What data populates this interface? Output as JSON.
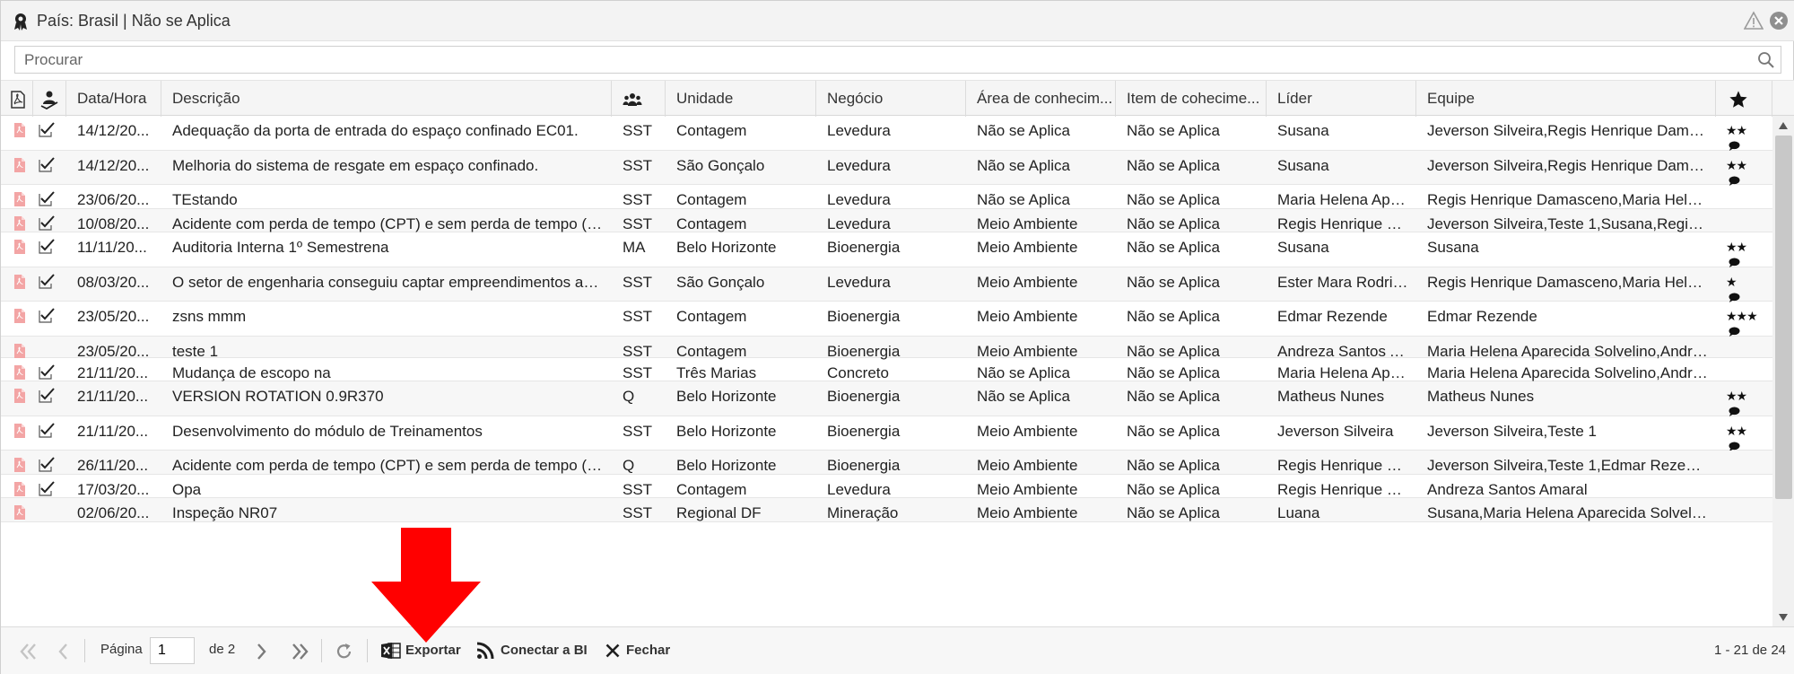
{
  "window": {
    "title": "País: Brasil | Não se Aplica"
  },
  "search": {
    "placeholder": "Procurar"
  },
  "columns": [
    {
      "key": "pdf",
      "label": ""
    },
    {
      "key": "check",
      "label": ""
    },
    {
      "key": "datetime",
      "label": "Data/Hora"
    },
    {
      "key": "description",
      "label": "Descrição"
    },
    {
      "key": "group",
      "label": ""
    },
    {
      "key": "unit",
      "label": "Unidade"
    },
    {
      "key": "business",
      "label": "Negócio"
    },
    {
      "key": "area",
      "label": "Área de conhecim..."
    },
    {
      "key": "item",
      "label": "Item de cohecime..."
    },
    {
      "key": "leader",
      "label": "Líder"
    },
    {
      "key": "team",
      "label": "Equipe"
    },
    {
      "key": "rating",
      "label": ""
    }
  ],
  "rows": [
    {
      "checked": true,
      "datetime": "14/12/20...",
      "description": "Adequação da porta de entrada do espaço confinado EC01.",
      "group": "SST",
      "unit": "Contagem",
      "business": "Levedura",
      "area": "Não se Aplica",
      "item": "Não se Aplica",
      "leader": "Susana",
      "team": "Jeverson Silveira,Regis Henrique Damasc...",
      "stars": "★★",
      "comment": true
    },
    {
      "checked": true,
      "datetime": "14/12/20...",
      "description": "Melhoria do sistema de resgate em espaço confinado.",
      "group": "SST",
      "unit": "São Gonçalo",
      "business": "Levedura",
      "area": "Não se Aplica",
      "item": "Não se Aplica",
      "leader": "Susana",
      "team": "Jeverson Silveira,Regis Henrique Damasc...",
      "stars": "★★",
      "comment": true
    },
    {
      "checked": true,
      "datetime": "23/06/20...",
      "description": "TEstando",
      "group": "SST",
      "unit": "Contagem",
      "business": "Levedura",
      "area": "Não se Aplica",
      "item": "Não se Aplica",
      "leader": "Maria Helena Apar...",
      "team": "Regis Henrique Damasceno,Maria Helena ...",
      "stars": "",
      "comment": false
    },
    {
      "checked": true,
      "datetime": "10/08/20...",
      "description": "Acidente com perda de tempo (CPT) e sem perda de tempo (SPT).",
      "group": "SST",
      "unit": "Contagem",
      "business": "Levedura",
      "area": "Meio Ambiente",
      "item": "Não se Aplica",
      "leader": "Regis Henrique Da...",
      "team": "Jeverson Silveira,Teste 1,Susana,Regis He...",
      "stars": "",
      "comment": false
    },
    {
      "checked": true,
      "datetime": "11/11/20...",
      "description": "Auditoria Interna 1º Semestrena",
      "group": "MA",
      "unit": "Belo Horizonte",
      "business": "Bioenergia",
      "area": "Meio Ambiente",
      "item": "Não se Aplica",
      "leader": "Susana",
      "team": "Susana",
      "stars": "★★",
      "comment": true
    },
    {
      "checked": true,
      "datetime": "08/03/20...",
      "description": "O setor de engenharia conseguiu captar empreendimentos ambie...",
      "group": "SST",
      "unit": "São Gonçalo",
      "business": "Levedura",
      "area": "Meio Ambiente",
      "item": "Não se Aplica",
      "leader": "Ester Mara Rodrig...",
      "team": "Regis Henrique Damasceno,Maria Helena ...",
      "stars": "★",
      "comment": true
    },
    {
      "checked": true,
      "datetime": "23/05/20...",
      "description": " zsns mmm",
      "group": "SST",
      "unit": "Contagem",
      "business": "Bioenergia",
      "area": "Meio Ambiente",
      "item": "Não se Aplica",
      "leader": "Edmar Rezende",
      "team": "Edmar Rezende",
      "stars": "★★★",
      "comment": true
    },
    {
      "checked": false,
      "datetime": "23/05/20...",
      "description": "teste 1",
      "group": "SST",
      "unit": "Contagem",
      "business": "Bioenergia",
      "area": "Meio Ambiente",
      "item": "Não se Aplica",
      "leader": "Andreza Santos A...",
      "team": "Maria Helena Aparecida Solvelino,Andrez...",
      "stars": "",
      "comment": false
    },
    {
      "checked": true,
      "datetime": "21/11/20...",
      "description": "Mudança de escopo na",
      "group": "SST",
      "unit": "Três Marias",
      "business": "Concreto",
      "area": "Não se Aplica",
      "item": "Não se Aplica",
      "leader": "Maria Helena Apar...",
      "team": "Maria Helena Aparecida Solvelino,Andrez...",
      "stars": "",
      "comment": false
    },
    {
      "checked": true,
      "datetime": "21/11/20...",
      "description": "VERSION ROTATION 0.9R370",
      "group": "Q",
      "unit": "Belo Horizonte",
      "business": "Bioenergia",
      "area": "Não se Aplica",
      "item": "Não se Aplica",
      "leader": "Matheus Nunes",
      "team": "Matheus Nunes",
      "stars": "★★",
      "comment": true
    },
    {
      "checked": true,
      "datetime": "21/11/20...",
      "description": "Desenvolvimento do módulo de Treinamentos",
      "group": "SST",
      "unit": "Belo Horizonte",
      "business": "Bioenergia",
      "area": "Meio Ambiente",
      "item": "Não se Aplica",
      "leader": "Jeverson Silveira",
      "team": "Jeverson Silveira,Teste 1",
      "stars": "★★",
      "comment": true
    },
    {
      "checked": true,
      "datetime": "26/11/20...",
      "description": "Acidente com perda de tempo (CPT) e sem perda de tempo (SPT).",
      "group": "Q",
      "unit": "Belo Horizonte",
      "business": "Bioenergia",
      "area": "Meio Ambiente",
      "item": "Não se Aplica",
      "leader": "Regis Henrique Da...",
      "team": "Jeverson Silveira,Teste 1,Edmar Rezende,...",
      "stars": "",
      "comment": false
    },
    {
      "checked": true,
      "datetime": "17/03/20...",
      "description": "Opa",
      "group": "SST",
      "unit": "Contagem",
      "business": "Levedura",
      "area": "Meio Ambiente",
      "item": "Não se Aplica",
      "leader": "Regis Henrique Da...",
      "team": "Andreza Santos Amaral",
      "stars": "",
      "comment": false
    },
    {
      "checked": false,
      "datetime": "02/06/20...",
      "description": "Inspeção NR07",
      "group": "SST",
      "unit": "Regional DF",
      "business": "Mineração",
      "area": "Meio Ambiente",
      "item": "Não se Aplica",
      "leader": "Luana",
      "team": "Susana,Maria Helena Aparecida Solvelino,...",
      "stars": "",
      "comment": false
    }
  ],
  "toolbar": {
    "page_label": "Página",
    "page_value": "1",
    "of_label": "de 2",
    "export_label": "Exportar",
    "bi_label": "Conectar a BI",
    "close_label": "Fechar",
    "paging_info": "1 - 21 de 24"
  },
  "colors": {
    "pdf_icon": "#f3a5a5",
    "arrow": "#ff0000",
    "excel_icon": "#1f1f1f"
  }
}
